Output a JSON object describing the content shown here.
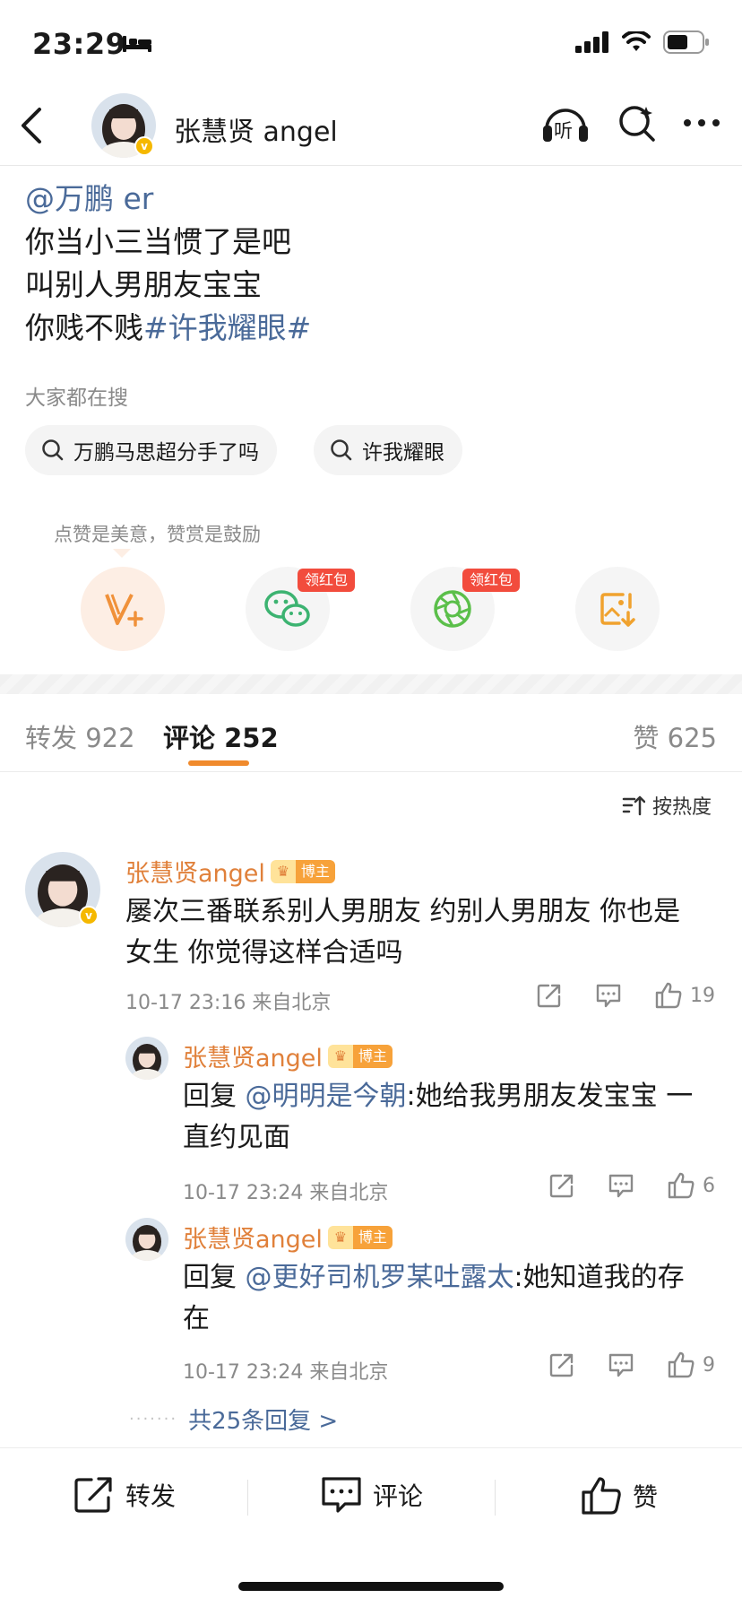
{
  "status_bar": {
    "time": "23:29"
  },
  "header": {
    "name": "张慧贤 angel",
    "listen_label": "听"
  },
  "post": {
    "mention": "@万鹏 er",
    "lines": [
      "你当小三当惯了是吧",
      "叫别人男朋友宝宝",
      "你贱不贱"
    ],
    "hashtag": "#许我耀眼#"
  },
  "search": {
    "title": "大家都在搜",
    "chips": [
      "万鹏马思超分手了吗",
      "许我耀眼"
    ]
  },
  "reward": {
    "tip": "点赞是美意，赞赏是鼓励",
    "tag_label": "领红包"
  },
  "tabs": {
    "repost": "转发 922",
    "comment": "评论 252",
    "like": "赞 625"
  },
  "sort_label": "按热度",
  "host_badge": "博主",
  "comments": [
    {
      "name": "张慧贤angel",
      "text_line1": "屡次三番联系别人男朋友 约别人男朋友 你也是",
      "text_line2": "女生 你觉得这样合适吗",
      "meta": "10-17 23:16  来自北京",
      "likes": "19"
    }
  ],
  "replies": [
    {
      "name": "张慧贤angel",
      "prefix": "回复 ",
      "mention": "@明明是今朝",
      "text_a": ":她给我男朋友发宝宝 一",
      "text_b": "直约见面",
      "meta": "10-17 23:24  来自北京",
      "likes": "6"
    },
    {
      "name": "张慧贤angel",
      "prefix": "回复 ",
      "mention": "@更好司机罗某吐露太",
      "text_a": ":她知道我的存",
      "text_b": "在",
      "meta": "10-17 23:24  来自北京",
      "likes": "9"
    }
  ],
  "more_replies": "共25条回复 >",
  "bottom_bar": {
    "repost": "转发",
    "comment": "评论",
    "like": "赞"
  },
  "colors": {
    "accent": "#f08a2c",
    "link": "#4a6a99",
    "name": "#e0803a",
    "red_tag": "#f24c3d"
  }
}
